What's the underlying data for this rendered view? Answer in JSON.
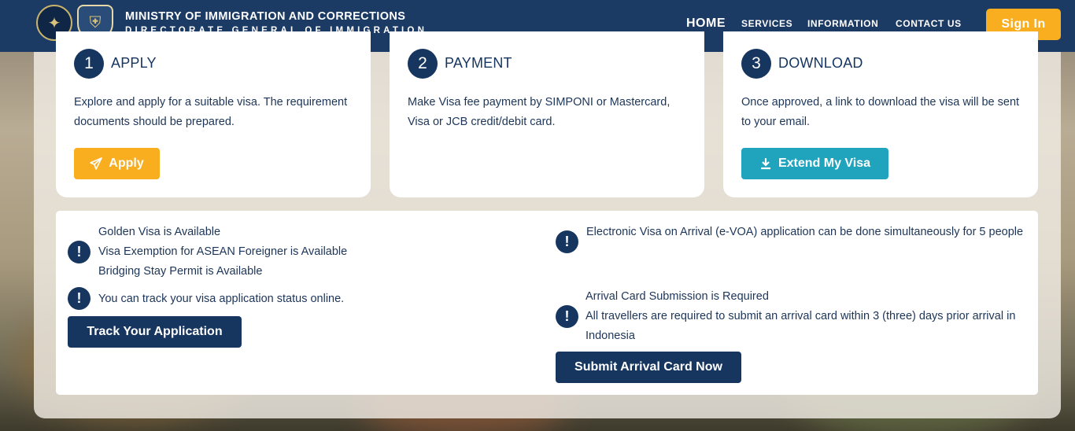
{
  "header": {
    "title_line1": "MINISTRY OF IMMIGRATION AND CORRECTIONS",
    "title_line2": "DIRECTORATE GENERAL OF IMMIGRATION",
    "nav": [
      "HOME",
      "SERVICES",
      "INFORMATION",
      "CONTACT US"
    ],
    "sign_in": "Sign In"
  },
  "steps": [
    {
      "number": "1",
      "title": "APPLY",
      "description": "Explore and apply for a suitable visa. The requirement documents should be prepared.",
      "button": "Apply"
    },
    {
      "number": "2",
      "title": "PAYMENT",
      "description": "Make Visa fee payment by SIMPONI or Mastercard, Visa or JCB credit/debit card."
    },
    {
      "number": "3",
      "title": "DOWNLOAD",
      "description": "Once approved, a link to download the visa will be sent to your email.",
      "button": "Extend My Visa"
    }
  ],
  "notices": {
    "left1": [
      "Golden Visa is Available",
      "Visa Exemption for ASEAN Foreigner is Available",
      "Bridging Stay Permit is Available"
    ],
    "left2": "You can track your visa application status online.",
    "track_button": "Track Your Application",
    "right1": "Electronic Visa on Arrival (e-VOA) application can be done simultaneously for 5 people",
    "right2_title": "Arrival Card Submission is Required",
    "right2_body": "All travellers are required to submit an arrival card within 3 (three) days prior arrival in Indonesia",
    "submit_button": "Submit Arrival Card Now"
  },
  "colors": {
    "navy": "#163660",
    "header": "#1b3a64",
    "amber": "#f8ae1f",
    "teal": "#20a4bd"
  }
}
